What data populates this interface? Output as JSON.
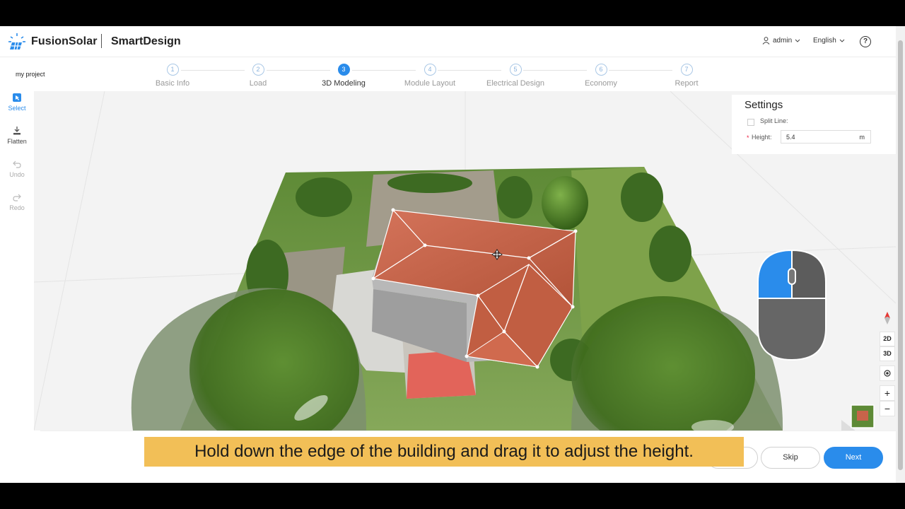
{
  "header": {
    "brand": "FusionSolar",
    "product": "SmartDesign",
    "user": "admin",
    "language": "English",
    "help": "?"
  },
  "project_name": "my project",
  "steps": [
    {
      "num": "1",
      "label": "Basic Info",
      "active": false
    },
    {
      "num": "2",
      "label": "Load",
      "active": false
    },
    {
      "num": "3",
      "label": "3D Modeling",
      "active": true
    },
    {
      "num": "4",
      "label": "Module Layout",
      "active": false
    },
    {
      "num": "5",
      "label": "Electrical Design",
      "active": false
    },
    {
      "num": "6",
      "label": "Economy",
      "active": false
    },
    {
      "num": "7",
      "label": "Report",
      "active": false
    }
  ],
  "tools": {
    "select": "Select",
    "flatten": "Flatten",
    "undo": "Undo",
    "redo": "Redo"
  },
  "settings": {
    "title": "Settings",
    "split_line_label": "Split Line:",
    "height_label": "Height:",
    "height_value": "5.4",
    "height_unit": "m"
  },
  "map_controls": {
    "view_2d": "2D",
    "view_3d": "3D",
    "zoom_in": "+",
    "zoom_out": "−"
  },
  "footer": {
    "skip": "Skip",
    "next": "Next"
  },
  "caption": "Hold down the edge of the building and drag it to adjust the height.",
  "colors": {
    "accent": "#2a8ceb",
    "caption_bg": "#f2bf57",
    "roof": "#c8644a",
    "grass": "#6a9a3a"
  }
}
